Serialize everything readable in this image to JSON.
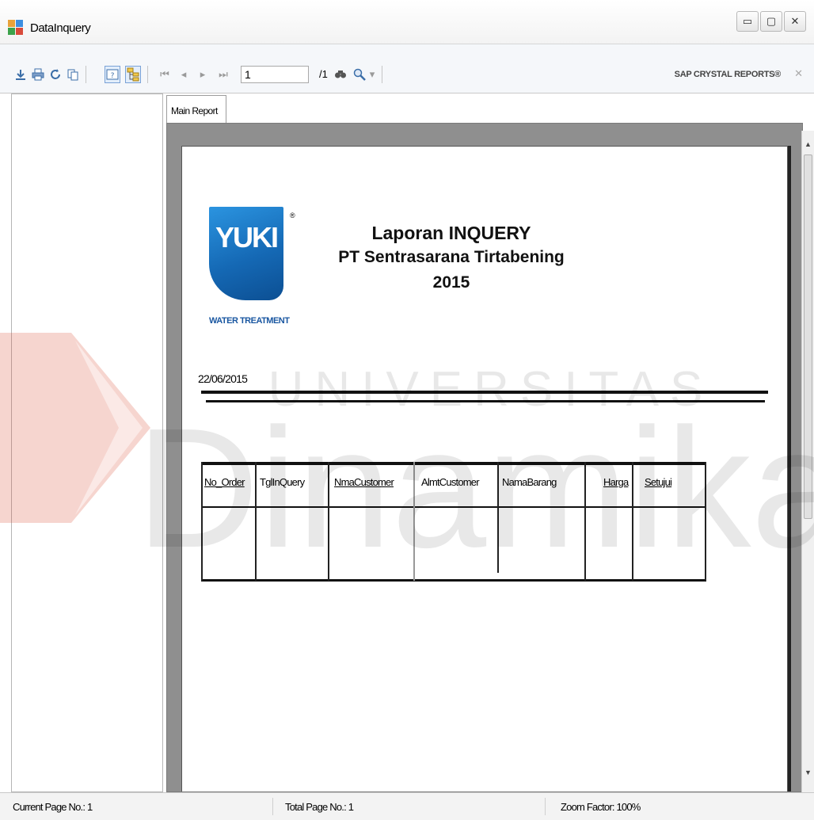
{
  "window": {
    "title": "DataInquery",
    "controls": {
      "minimize": "▭",
      "maximize": "▢",
      "close": "✕"
    }
  },
  "toolbar": {
    "page_value": "1",
    "page_total": "/1",
    "brand": "SAP CRYSTAL REPORTS®",
    "icons": [
      "export-icon",
      "print-icon",
      "refresh-icon",
      "copy-icon",
      "toggle-parameter-panel-icon",
      "toggle-group-tree-icon",
      "first-page-icon",
      "previous-page-icon",
      "next-page-icon",
      "last-page-icon",
      "find-icon",
      "zoom-icon"
    ]
  },
  "tabs": [
    {
      "label": "Main Report"
    }
  ],
  "report": {
    "logo_text": "YUKI",
    "logo_registered": "®",
    "logo_caption": "WATER TREATMENT",
    "title_line1": "Laporan INQUERY",
    "title_line2": "PT Sentrasarana Tirtabening",
    "title_line3": "2015",
    "date": "22/06/2015",
    "columns": [
      "No_Order",
      "TglInQuery",
      "NmaCustomer",
      "AlmtCustomer",
      "NamaBarang",
      "Harga",
      "Setujui"
    ],
    "logo_colors": {
      "top": "#2b94e0",
      "bottom": "#0c4f93"
    }
  },
  "status_bar": {
    "current_page": "Current Page No.: 1",
    "total_page": "Total Page No.: 1",
    "zoom": "Zoom Factor: 100%"
  },
  "watermark": {
    "line1": "UNIVERSITAS",
    "line2": "Dinamika"
  }
}
